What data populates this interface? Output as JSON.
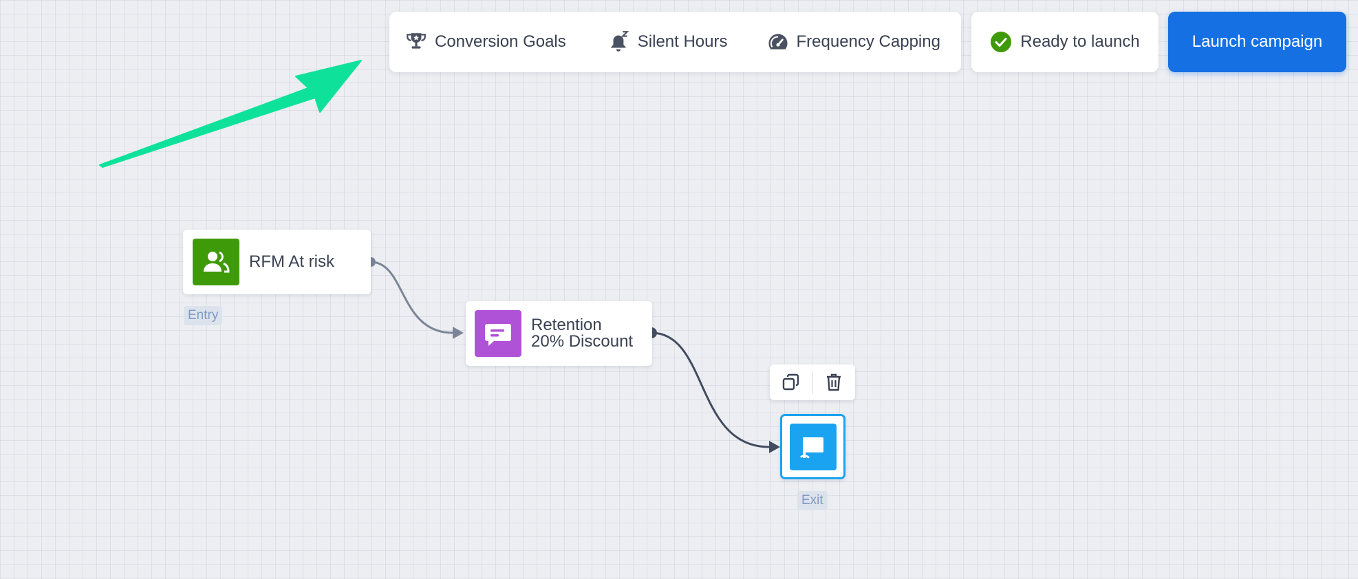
{
  "toolbar": {
    "items": [
      {
        "label": "Conversion Goals",
        "icon": "trophy-icon"
      },
      {
        "label": "Silent Hours",
        "icon": "bell-sleep-icon"
      },
      {
        "label": "Frequency Capping",
        "icon": "speedometer-icon"
      }
    ]
  },
  "status": {
    "label": "Ready to launch",
    "icon": "check-circle-icon",
    "color": "#3f9a0a"
  },
  "launch": {
    "label": "Launch campaign",
    "color": "#1570e3"
  },
  "flow": {
    "entry": {
      "label": "RFM At risk",
      "tag": "Entry",
      "icon": "users-icon",
      "color": "#3f9a0a"
    },
    "message": {
      "line1": "Retention",
      "line2": "20% Discount",
      "icon": "message-icon",
      "color": "#b052d8"
    },
    "exit": {
      "tag": "Exit",
      "icon": "flag-icon",
      "color": "#1aa3f0"
    },
    "node_actions": [
      {
        "icon": "copy-icon"
      },
      {
        "icon": "trash-icon"
      }
    ]
  },
  "annotation": {
    "color": "#0ee29a",
    "icon": "arrow-annotation"
  }
}
